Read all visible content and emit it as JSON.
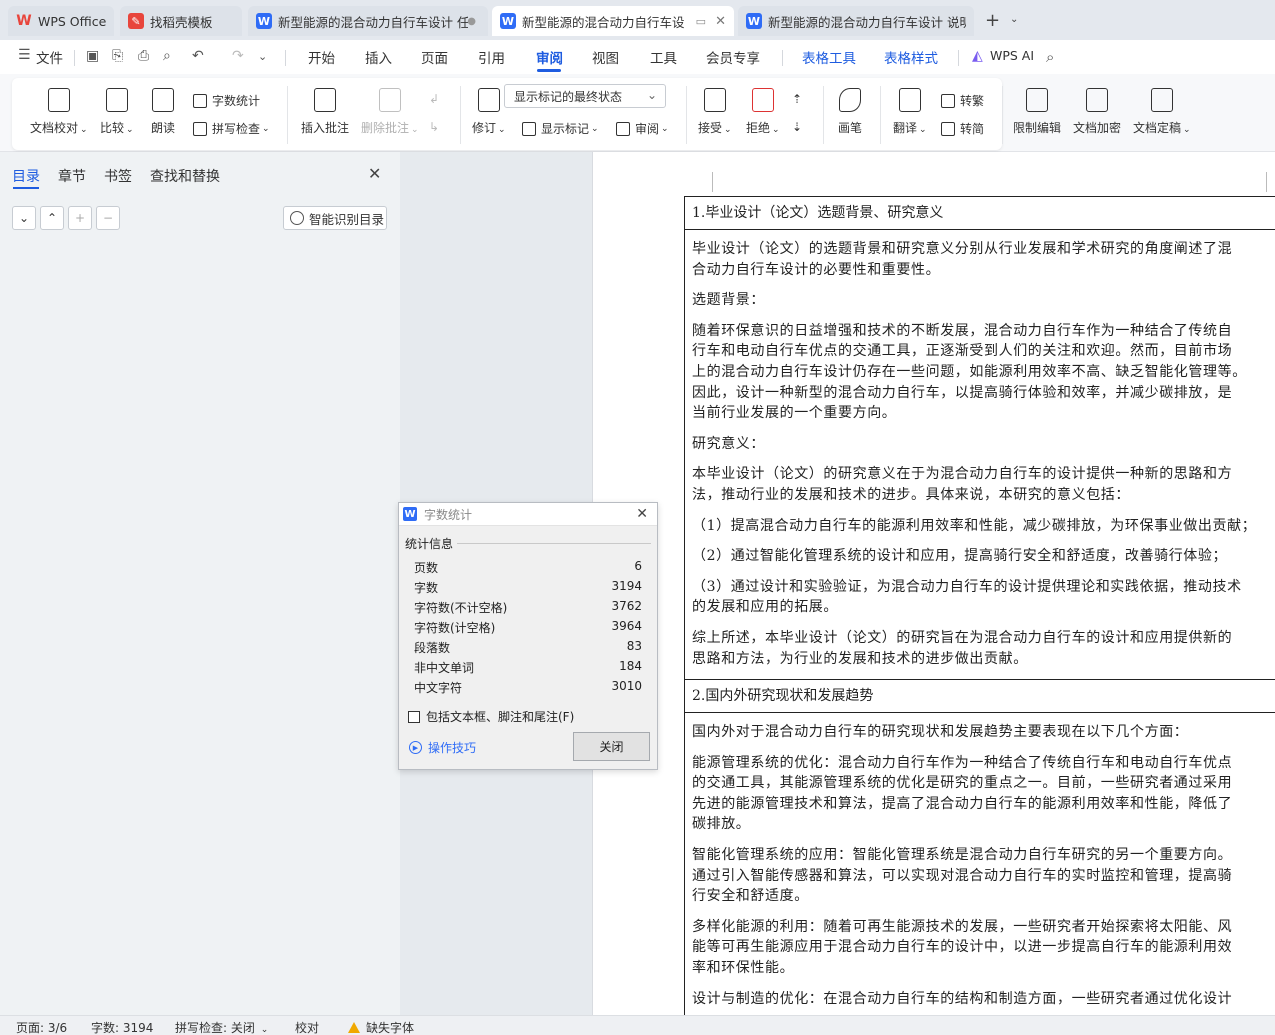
{
  "tabs": [
    {
      "label": "WPS Office",
      "icon": "wps-logo-icon",
      "state": "inactive"
    },
    {
      "label": "找稻壳模板",
      "icon": "docer-icon",
      "state": "inactive"
    },
    {
      "label": "新型能源的混合动力自行车设计 任",
      "icon": "writer-doc-icon",
      "state": "inactive"
    },
    {
      "label": "新型能源的混合动力自行车设",
      "icon": "writer-doc-icon",
      "state": "active"
    },
    {
      "label": "新型能源的混合动力自行车设计 说明",
      "icon": "writer-doc-icon",
      "state": "inactive"
    }
  ],
  "menu": {
    "file": "文件",
    "items": [
      "开始",
      "插入",
      "页面",
      "引用",
      "审阅",
      "视图",
      "工具",
      "会员专享"
    ],
    "active": "审阅",
    "table_tools": "表格工具",
    "table_style": "表格样式",
    "wps_ai": "WPS AI"
  },
  "ribbon": {
    "doc_check": "文档校对",
    "compare": "比较",
    "read_aloud": "朗读",
    "word_count": "字数统计",
    "spell_check": "拼写检查",
    "insert_comment": "插入批注",
    "delete_comment": "删除批注",
    "track_changes": "修订",
    "display_mode": "显示标记的最终状态",
    "show_markup": "显示标记",
    "review_pane": "审阅",
    "accept": "接受",
    "reject": "拒绝",
    "pen": "画笔",
    "translate": "翻译",
    "to_traditional": "转繁",
    "to_simplified": "转简",
    "restrict_edit": "限制编辑",
    "encrypt": "文档加密",
    "finalize": "文档定稿"
  },
  "nav": {
    "tabs": [
      "目录",
      "章节",
      "书签",
      "查找和替换"
    ],
    "active_tab": "目录",
    "smart_toc": "智能识别目录"
  },
  "document": {
    "sections": [
      {
        "heading": "1.毕业设计（论文）选题背景、研究意义",
        "paragraphs": [
          [
            "毕业设计（论文）的选题背景和研究意义分别从行业发展和学术研究的角度阐述了混",
            "合动力自行车设计的必要性和重要性。"
          ],
          [
            "选题背景："
          ],
          [
            "随着环保意识的日益增强和技术的不断发展，混合动力自行车作为一种结合了传统自",
            "行车和电动自行车优点的交通工具，正逐渐受到人们的关注和欢迎。然而，目前市场",
            "上的混合动力自行车设计仍存在一些问题，如能源利用效率不高、缺乏智能化管理等。",
            "因此，设计一种新型的混合动力自行车，以提高骑行体验和效率，并减少碳排放，是",
            "当前行业发展的一个重要方向。"
          ],
          [
            "研究意义："
          ],
          [
            "本毕业设计（论文）的研究意义在于为混合动力自行车的设计提供一种新的思路和方",
            "法，推动行业的发展和技术的进步。具体来说，本研究的意义包括："
          ],
          [
            "（1）提高混合动力自行车的能源利用效率和性能，减少碳排放，为环保事业做出贡献；"
          ],
          [
            "（2）通过智能化管理系统的设计和应用，提高骑行安全和舒适度，改善骑行体验；"
          ],
          [
            "（3）通过设计和实验验证，为混合动力自行车的设计提供理论和实践依据，推动技术",
            "的发展和应用的拓展。"
          ],
          [
            "综上所述，本毕业设计（论文）的研究旨在为混合动力自行车的设计和应用提供新的",
            "思路和方法，为行业的发展和技术的进步做出贡献。"
          ]
        ]
      },
      {
        "heading": "2.国内外研究现状和发展趋势",
        "paragraphs": [
          [
            "国内外对于混合动力自行车的研究现状和发展趋势主要表现在以下几个方面："
          ],
          [
            "能源管理系统的优化：混合动力自行车作为一种结合了传统自行车和电动自行车优点",
            "的交通工具，其能源管理系统的优化是研究的重点之一。目前，一些研究者通过采用",
            "先进的能源管理技术和算法，提高了混合动力自行车的能源利用效率和性能，降低了",
            "碳排放。"
          ],
          [
            "智能化管理系统的应用：智能化管理系统是混合动力自行车研究的另一个重要方向。",
            "通过引入智能传感器和算法，可以实现对混合动力自行车的实时监控和管理，提高骑",
            "行安全和舒适度。"
          ],
          [
            "多样化能源的利用：随着可再生能源技术的发展，一些研究者开始探索将太阳能、风",
            "能等可再生能源应用于混合动力自行车的设计中，以进一步提高自行车的能源利用效",
            "率和环保性能。"
          ],
          [
            "设计与制造的优化：在混合动力自行车的结构和制造方面，一些研究者通过优化设计"
          ]
        ]
      }
    ]
  },
  "dialog": {
    "title": "字数统计",
    "group": "统计信息",
    "stats": [
      {
        "label": "页数",
        "value": "6"
      },
      {
        "label": "字数",
        "value": "3194"
      },
      {
        "label": "字符数(不计空格)",
        "value": "3762"
      },
      {
        "label": "字符数(计空格)",
        "value": "3964"
      },
      {
        "label": "段落数",
        "value": "83"
      },
      {
        "label": "非中文单词",
        "value": "184"
      },
      {
        "label": "中文字符",
        "value": "3010"
      }
    ],
    "include_label": "包括文本框、脚注和尾注(F)",
    "tips": "操作技巧",
    "close": "关闭"
  },
  "status": {
    "page": "页面: 3/6",
    "words": "字数: 3194",
    "spell": "拼写检查: 关闭",
    "proof": "校对",
    "missing_font": "缺失字体"
  },
  "colors": {
    "accent": "#1e5ce0",
    "nav_bg": "#eff2f4",
    "doc_bg": "#e6eaee"
  }
}
